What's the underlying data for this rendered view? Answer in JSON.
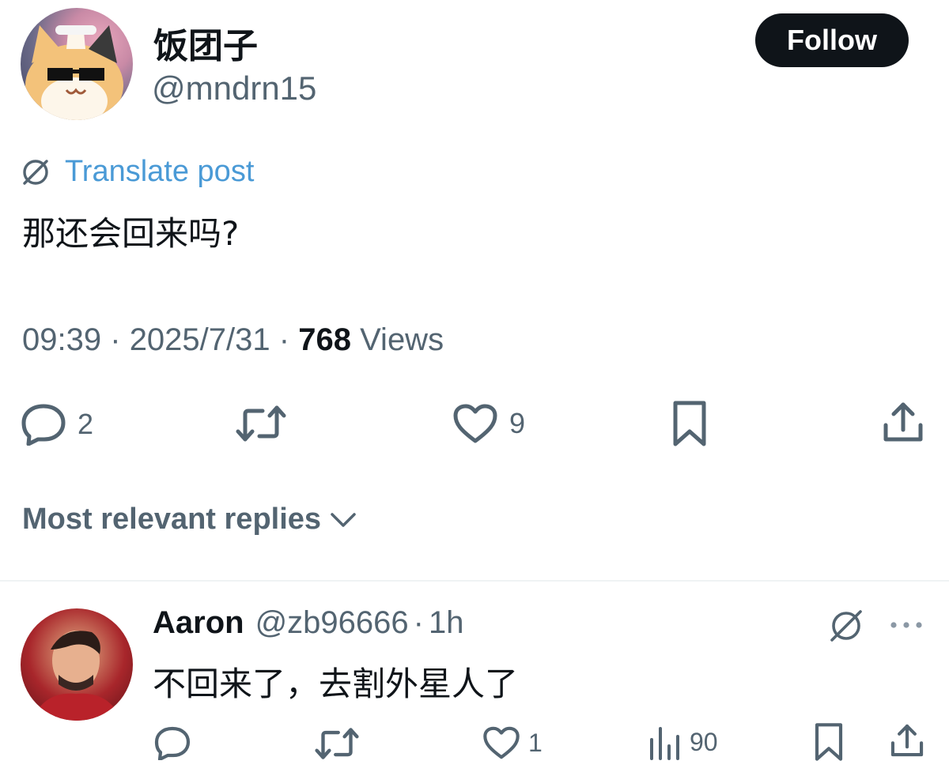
{
  "post": {
    "author": {
      "display_name": "饭团子",
      "handle": "@mndrn15"
    },
    "follow_label": "Follow",
    "translate_label": "Translate post",
    "text": "那还会回来吗?",
    "time": "09:39",
    "date": "2025/7/31",
    "views_count": "768",
    "views_label": "Views",
    "separator": "·",
    "actions": {
      "replies": "2",
      "likes": "9"
    }
  },
  "replies_section": {
    "sort_label": "Most relevant replies"
  },
  "reply": {
    "display_name": "Aaron",
    "handle": "@zb96666",
    "separator": "·",
    "time": "1h",
    "text": "不回来了，去割外星人了",
    "actions": {
      "likes": "1",
      "views": "90"
    }
  },
  "colors": {
    "text": "#0f1419",
    "secondary": "#536471",
    "link": "#4a9ad6",
    "button_bg": "#0f1419",
    "divider": "#eff3f4"
  }
}
